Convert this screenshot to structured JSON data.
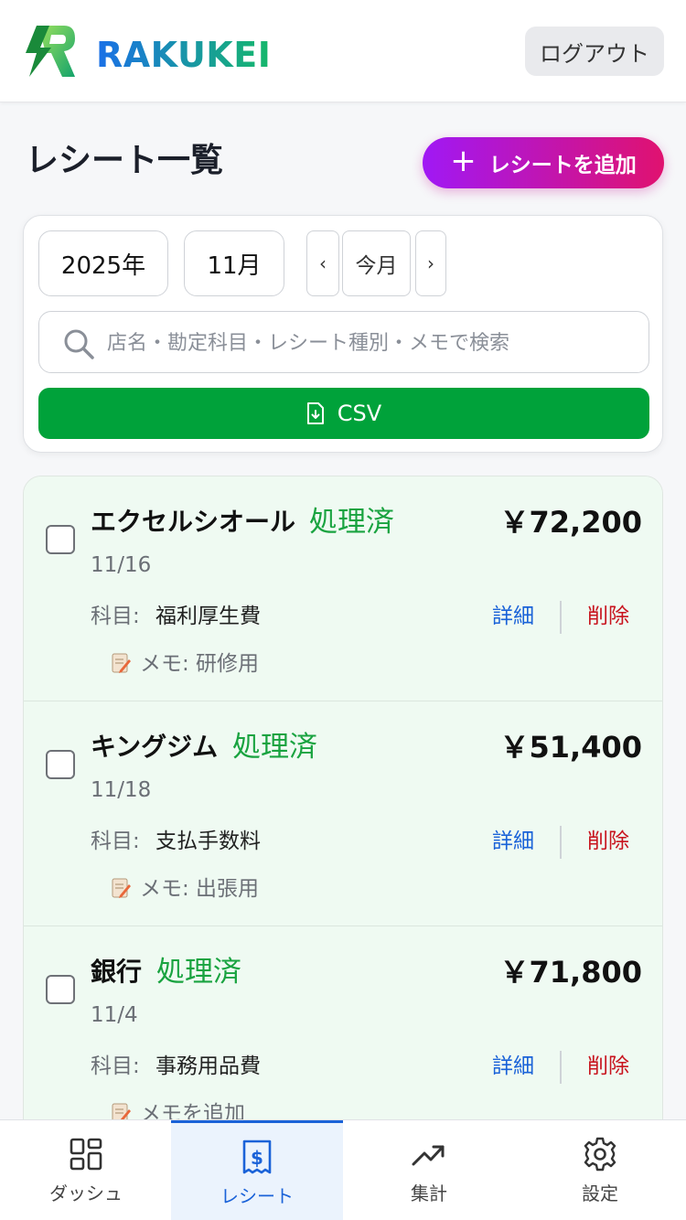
{
  "header": {
    "brand": "RAKUKEI",
    "logout_label": "ログアウト"
  },
  "page": {
    "title": "レシート一覧",
    "add_label": "レシートを追加"
  },
  "filters": {
    "year": "2025年",
    "month": "11月",
    "prev": "‹",
    "today": "今月",
    "next": "›",
    "search_placeholder": "店名・勘定科目・レシート種別・メモで検索",
    "csv_label": "CSV"
  },
  "receipts": [
    {
      "store": "エクセルシオール",
      "status": "処理済",
      "amount": "￥72,200",
      "date": "11/16",
      "category_label": "科目:",
      "category": "福利厚生費",
      "detail": "詳細",
      "delete": "削除",
      "memo": "メモ: 研修用"
    },
    {
      "store": "キングジム",
      "status": "処理済",
      "amount": "￥51,400",
      "date": "11/18",
      "category_label": "科目:",
      "category": "支払手数料",
      "detail": "詳細",
      "delete": "削除",
      "memo": "メモ: 出張用"
    },
    {
      "store": "銀行",
      "status": "処理済",
      "amount": "￥71,800",
      "date": "11/4",
      "category_label": "科目:",
      "category": "事務用品費",
      "detail": "詳細",
      "delete": "削除",
      "memo": "メモを追加"
    }
  ],
  "nav": {
    "dashboard": "ダッシュ",
    "receipts": "レシート",
    "summary": "集計",
    "settings": "設定"
  },
  "colors": {
    "accent_blue": "#1a62d8",
    "status_green": "#19a340",
    "csv_green": "#00a23a",
    "delete_red": "#c8141e",
    "gradient_start": "#a018f5",
    "gradient_end": "#e0126f"
  }
}
